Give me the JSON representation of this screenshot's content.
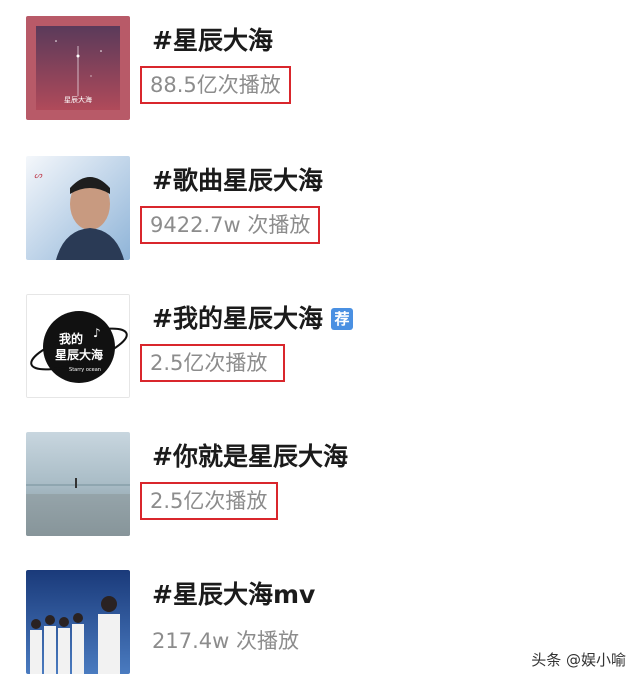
{
  "items": [
    {
      "title": "#星辰大海",
      "count": "88.5亿次播放",
      "boxed": true,
      "thumb_text": "星辰大海"
    },
    {
      "title": "#歌曲星辰大海",
      "count": "9422.7w 次播放",
      "boxed": true,
      "thumb_text": ""
    },
    {
      "title": "#我的星辰大海",
      "badge": "荐",
      "count": "2.5亿次播放",
      "boxed": true,
      "thumb_text": "我的星辰大海",
      "thumb_subtext": "Starry ocean"
    },
    {
      "title": "#你就是星辰大海",
      "count": "2.5亿次播放",
      "boxed": true,
      "thumb_text": ""
    },
    {
      "title": "#星辰大海mv",
      "count": "217.4w 次播放",
      "boxed": false,
      "thumb_text": ""
    }
  ],
  "watermark": "头条 @娱小喻",
  "colors": {
    "highlight_box": "#d9262c",
    "badge": "#4a90e2"
  }
}
